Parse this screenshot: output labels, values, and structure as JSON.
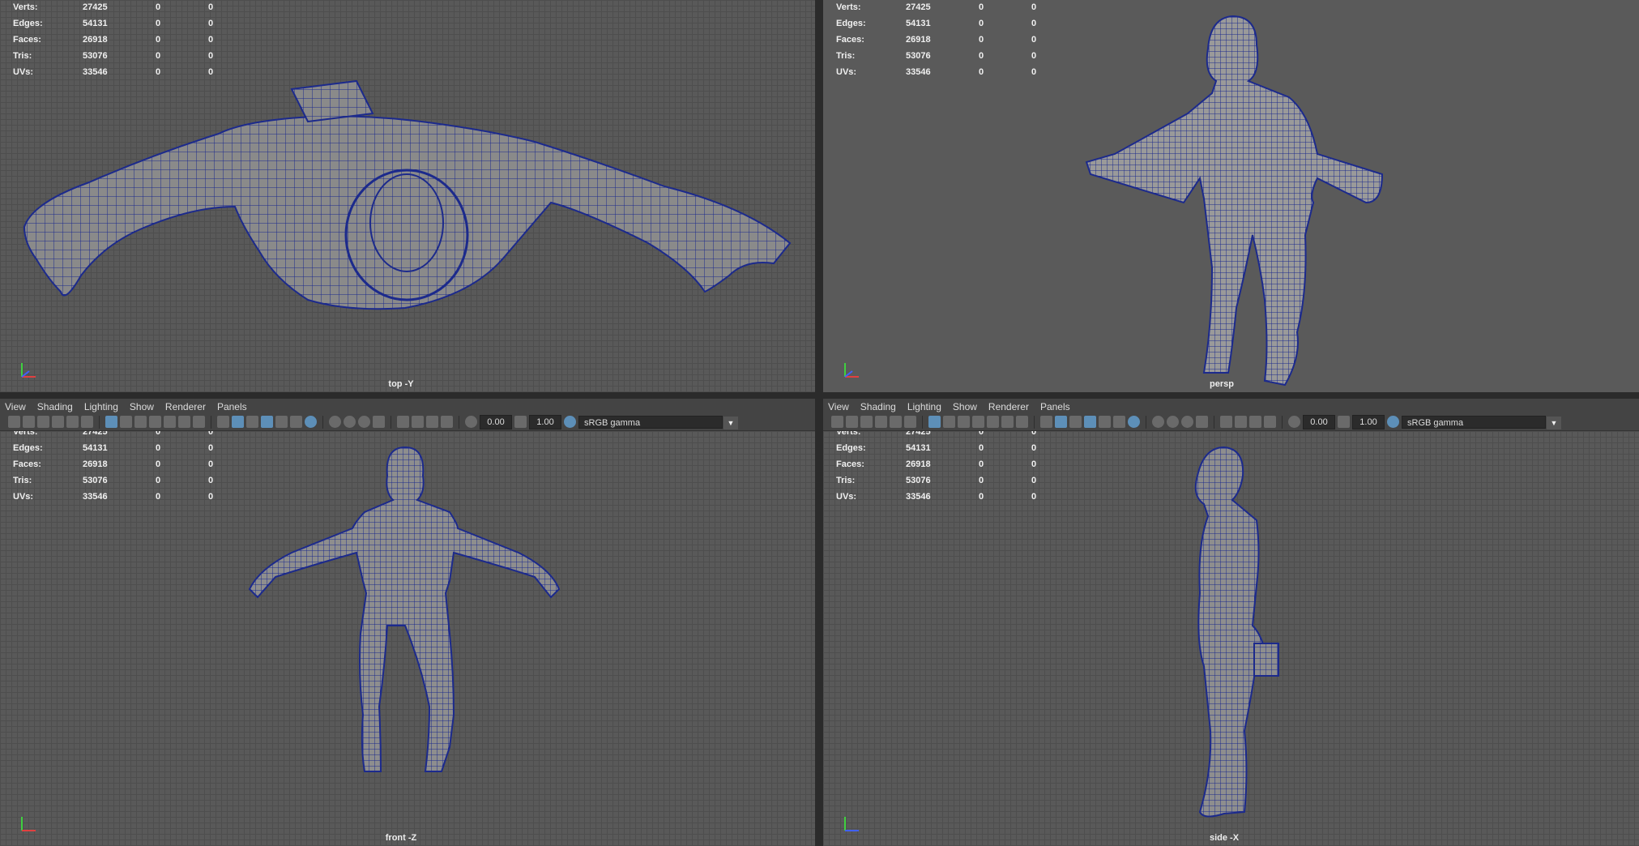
{
  "stats_labels": [
    "Verts:",
    "Edges:",
    "Faces:",
    "Tris:",
    "UVs:"
  ],
  "stats_values": [
    [
      "27425",
      "0",
      "0"
    ],
    [
      "54131",
      "0",
      "0"
    ],
    [
      "26918",
      "0",
      "0"
    ],
    [
      "53076",
      "0",
      "0"
    ],
    [
      "33546",
      "0",
      "0"
    ]
  ],
  "viewports": {
    "top": {
      "label": "top -Y"
    },
    "persp": {
      "label": "persp"
    },
    "front": {
      "label": "front -Z"
    },
    "side": {
      "label": "side -X"
    }
  },
  "menu": [
    "View",
    "Shading",
    "Lighting",
    "Show",
    "Renderer",
    "Panels"
  ],
  "toolbar": {
    "exposure": "0.00",
    "gamma": "1.00",
    "color_space": "sRGB gamma"
  },
  "colors": {
    "wire": "#1c2a8c",
    "mesh_fill": "#8c8c8c",
    "accent": "#5d8fb8",
    "axis_x": "#e04040",
    "axis_y": "#40d040",
    "axis_z": "#4060ff"
  },
  "icons": [
    "camera-icon",
    "grid-icon",
    "wireframe-icon",
    "shaded-icon",
    "lighting-icon",
    "xray-icon",
    "exposure-icon",
    "gamma-icon",
    "color-management-icon"
  ]
}
